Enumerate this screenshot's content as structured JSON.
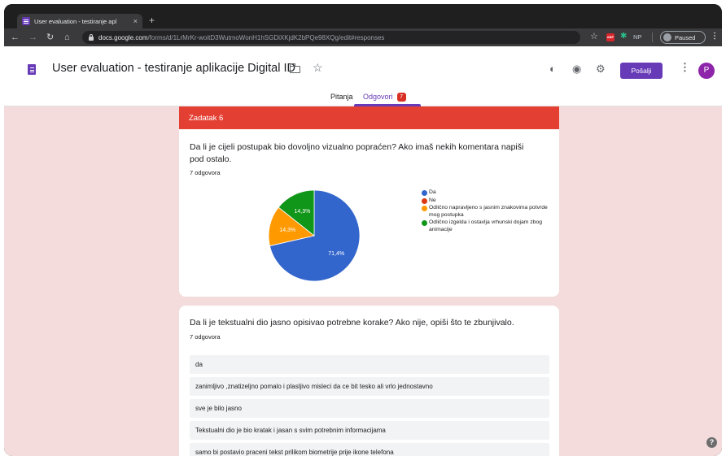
{
  "browser": {
    "tab_title": "User evaluation - testiranje apl",
    "tab_close": "×",
    "new_tab": "+",
    "url_host": "docs.google.com",
    "url_path": "/forms/d/1LrMrKr-woitD3WutmoWonH1hSGDiXKjdK2bPQe98XQg/edit#responses",
    "extension_np": "NP",
    "profile_status": "Paused"
  },
  "form": {
    "title": "User evaluation - testiranje aplikacije Digital ID",
    "send_label": "Pošalji",
    "avatar_letter": "P",
    "tabs": [
      {
        "label": "Pitanja"
      },
      {
        "label": "Odgovori",
        "badge": "7"
      }
    ]
  },
  "section": {
    "header": "Zadatak 6",
    "question1": {
      "text": "Da li je cijeli postupak bio dovoljno vizualno popraćen? Ako imaš nekih komentara napiši pod ostalo.",
      "count": "7 odgovora"
    },
    "question2": {
      "text": "Da li je tekstualni dio jasno opisivao potrebne korake? Ako nije, opiši što te zbunjivalo.",
      "count": "7 odgovora",
      "answers": [
        "da",
        "zanimljivo ,znatizeljno pomalo i plasljivo misleci da ce bit tesko ali vrlo jednostavno",
        "sve je bilo jasno",
        "Tekstualni dio je bio kratak i jasan s svim potrebnim informacijama",
        "samo bi postavio praceni tekst prilikom biometrije prije ikone telefona"
      ]
    }
  },
  "chart_data": {
    "type": "pie",
    "title": "",
    "slices": [
      {
        "label": "Da",
        "value": 71.4,
        "display": "71,4%",
        "color": "#3366cc"
      },
      {
        "label": "Ne",
        "value": 0,
        "display": "",
        "color": "#dc3912"
      },
      {
        "label": "Odlično napravljeno s jasnim znakovima potvrde mog postupka",
        "value": 14.3,
        "display": "14,3%",
        "color": "#ff9900"
      },
      {
        "label": "Odlično izgelda i ostavlja vrhunski dojam zbog animacije",
        "value": 14.3,
        "display": "14,3%",
        "color": "#109618"
      }
    ],
    "legend_position": "right"
  },
  "colors": {
    "accent": "#673ab7",
    "section_band": "#e43f33",
    "background": "#f4dcdc"
  },
  "help_label": "?"
}
